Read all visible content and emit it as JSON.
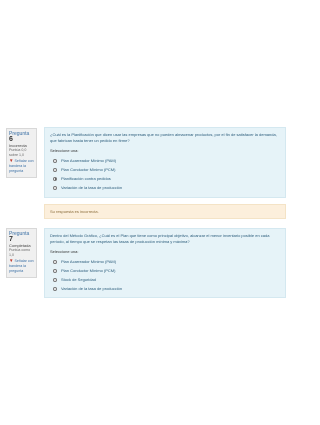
{
  "questions": [
    {
      "number_label": "Pregunta",
      "number": "6",
      "state": "Incorrecta",
      "grade": "Puntúa 0,0 sobre 1,0",
      "flag_label": "Señalar con bandera la pregunta",
      "text": "¿Cuál es la Planificación que dicen usar las empresas que no pueden almacenar productos, por el fin de satisfacer la demanda, que fabrican hasta tener un pedido en firme?",
      "prompt": "Seleccione una:",
      "options": [
        {
          "label": "Plan Acarreador Mínimo (PAM)",
          "selected": false
        },
        {
          "label": "Plan Conductor Mínimo (PCM)",
          "selected": false
        },
        {
          "label": "Planificación contra pedidos",
          "selected": true
        },
        {
          "label": "Variación de la tasa de producción",
          "selected": false
        }
      ],
      "feedback": "Su respuesta es incorrecta."
    },
    {
      "number_label": "Pregunta",
      "number": "7",
      "state": "Completada",
      "grade": "Puntúa como 1,0",
      "flag_label": "Señalar con bandera la pregunta",
      "text": "Dentro del Método Gráfico, ¿Cuál es el Plan que tiene como principal objetivo, alcanzar el menor inventario posible en cada período, al tiempo que se respetan las tasas de producción mínima y máxima?",
      "prompt": "Seleccione una:",
      "options": [
        {
          "label": "Plan Acarreador Mínimo (PAM)",
          "selected": false
        },
        {
          "label": "Plan Conductor Mínimo (PCM)",
          "selected": false
        },
        {
          "label": "Stock de Seguridad",
          "selected": false
        },
        {
          "label": "Variación de la tasa de producción",
          "selected": false
        }
      ]
    }
  ]
}
